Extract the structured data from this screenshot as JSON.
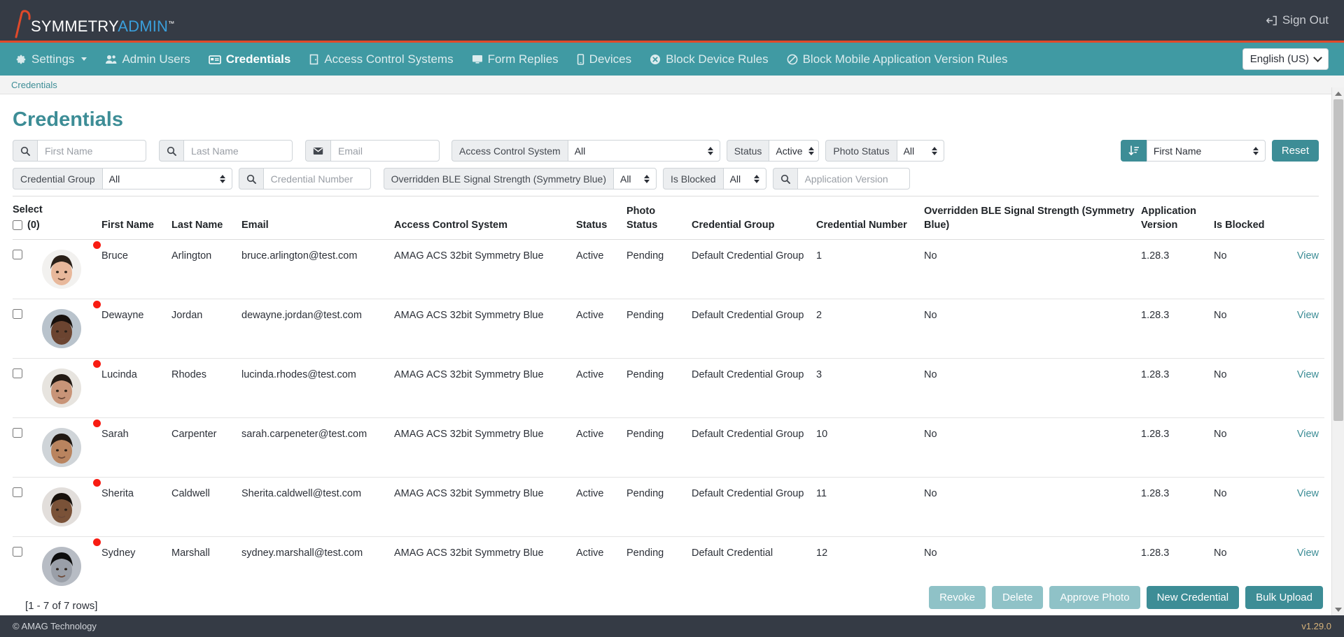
{
  "brand": {
    "name_primary": "SYMMETRY",
    "name_secondary": "ADMIN",
    "trademark": "™",
    "colors": {
      "navy": "#353b45",
      "teal": "#409aa3",
      "accent_red": "#e0492a",
      "link_teal": "#3d8d96",
      "logo_blue": "#3a9fdb"
    }
  },
  "topbar": {
    "sign_out_label": "Sign Out",
    "sign_out_icon": "sign-out-icon"
  },
  "nav": {
    "items": [
      {
        "label": "Settings",
        "icon": "gear-icon",
        "active": false,
        "has_caret": true
      },
      {
        "label": "Admin Users",
        "icon": "users-icon",
        "active": false,
        "has_caret": false
      },
      {
        "label": "Credentials",
        "icon": "card-icon",
        "active": true,
        "has_caret": false
      },
      {
        "label": "Access Control Systems",
        "icon": "door-icon",
        "active": false,
        "has_caret": false
      },
      {
        "label": "Form Replies",
        "icon": "monitor-icon",
        "active": false,
        "has_caret": false
      },
      {
        "label": "Devices",
        "icon": "mobile-icon",
        "active": false,
        "has_caret": false
      },
      {
        "label": "Block Device Rules",
        "icon": "circle-x-icon",
        "active": false,
        "has_caret": false
      },
      {
        "label": "Block Mobile Application Version Rules",
        "icon": "ban-icon",
        "active": false,
        "has_caret": false
      }
    ],
    "language": {
      "value": "English (US)",
      "icon": "chevron-down-icon"
    }
  },
  "breadcrumb": {
    "items": [
      "Credentials"
    ]
  },
  "page": {
    "title": "Credentials"
  },
  "filters": {
    "row1": [
      {
        "type": "search",
        "name": "first-name",
        "icon": "search-icon",
        "placeholder": "First Name",
        "value": ""
      },
      {
        "type": "search",
        "name": "last-name",
        "icon": "search-icon",
        "placeholder": "Last Name",
        "value": ""
      },
      {
        "type": "search",
        "name": "email",
        "icon": "envelope-icon",
        "placeholder": "Email",
        "value": ""
      },
      {
        "type": "select",
        "name": "access-control-system",
        "label": "Access Control System",
        "value": "All"
      },
      {
        "type": "select",
        "name": "status",
        "label": "Status",
        "value": "Active"
      },
      {
        "type": "select",
        "name": "photo-status",
        "label": "Photo Status",
        "value": "All"
      }
    ],
    "sort": {
      "label": "First Name",
      "icon": "sort-icon"
    },
    "reset_label": "Reset",
    "row2": [
      {
        "type": "select",
        "name": "credential-group",
        "label": "Credential Group",
        "value": "All"
      },
      {
        "type": "search",
        "name": "credential-number",
        "icon": "search-icon",
        "placeholder": "Credential Number",
        "value": ""
      },
      {
        "type": "select",
        "name": "overridden-ble-signal-strength",
        "label": "Overridden BLE Signal Strength (Symmetry Blue)",
        "value": "All"
      },
      {
        "type": "select",
        "name": "is-blocked",
        "label": "Is Blocked",
        "value": "All"
      },
      {
        "type": "search",
        "name": "application-version",
        "icon": "search-icon",
        "placeholder": "Application Version",
        "value": ""
      }
    ]
  },
  "table": {
    "select_header": "Select",
    "select_count": "(0)",
    "columns": [
      "First Name",
      "Last Name",
      "Email",
      "Access Control System",
      "Status",
      "Photo Status",
      "Credential Group",
      "Credential Number",
      "Overridden BLE Signal Strength (Symmetry Blue)",
      "Application Version",
      "Is Blocked"
    ],
    "view_label": "View",
    "rows": [
      {
        "first_name": "Bruce",
        "last_name": "Arlington",
        "email": "bruce.arlington@test.com",
        "acs": "AMAG ACS 32bit Symmetry Blue",
        "status": "Active",
        "photo_status": "Pending",
        "credential_group": "Default Credential Group",
        "credential_number": "1",
        "ble": "No",
        "app_version": "1.28.3",
        "is_blocked": "No",
        "avatar_skin": "#e8b89b",
        "avatar_hair": "#2b2119",
        "avatar_bg": "#f2f1ef"
      },
      {
        "first_name": "Dewayne",
        "last_name": "Jordan",
        "email": "dewayne.jordan@test.com",
        "acs": "AMAG ACS 32bit Symmetry Blue",
        "status": "Active",
        "photo_status": "Pending",
        "credential_group": "Default Credential Group",
        "credential_number": "2",
        "ble": "No",
        "app_version": "1.28.3",
        "is_blocked": "No",
        "avatar_skin": "#6b4430",
        "avatar_hair": "#17100c",
        "avatar_bg": "#b9c3cc"
      },
      {
        "first_name": "Lucinda",
        "last_name": "Rhodes",
        "email": "lucinda.rhodes@test.com",
        "acs": "AMAG ACS 32bit Symmetry Blue",
        "status": "Active",
        "photo_status": "Pending",
        "credential_group": "Default Credential Group",
        "credential_number": "3",
        "ble": "No",
        "app_version": "1.28.3",
        "is_blocked": "No",
        "avatar_skin": "#c89478",
        "avatar_hair": "#231a14",
        "avatar_bg": "#e7e4df"
      },
      {
        "first_name": "Sarah",
        "last_name": "Carpenter",
        "email": "sarah.carpeneter@test.com",
        "acs": "AMAG ACS 32bit Symmetry Blue",
        "status": "Active",
        "photo_status": "Pending",
        "credential_group": "Default Credential Group",
        "credential_number": "10",
        "ble": "No",
        "app_version": "1.28.3",
        "is_blocked": "No",
        "avatar_skin": "#b9845f",
        "avatar_hair": "#211913",
        "avatar_bg": "#cfd4d8"
      },
      {
        "first_name": "Sherita",
        "last_name": "Caldwell",
        "email": "Sherita.caldwell@test.com",
        "acs": "AMAG ACS 32bit Symmetry Blue",
        "status": "Active",
        "photo_status": "Pending",
        "credential_group": "Default Credential Group",
        "credential_number": "11",
        "ble": "No",
        "app_version": "1.28.3",
        "is_blocked": "No",
        "avatar_skin": "#7a5238",
        "avatar_hair": "#18110c",
        "avatar_bg": "#e2dedb"
      },
      {
        "first_name": "Sydney",
        "last_name": "Marshall",
        "email": "sydney.marshall@test.com",
        "acs": "AMAG ACS 32bit Symmetry Blue",
        "status": "Active",
        "photo_status": "Pending",
        "credential_group": "Default Credential",
        "credential_number": "12",
        "ble": "No",
        "app_version": "1.28.3",
        "is_blocked": "No",
        "avatar_skin": "#9a9fa8",
        "avatar_hair": "#0d0d0d",
        "avatar_bg": "#b7bcc4"
      }
    ],
    "rows_info": "[1 - 7 of 7 rows]"
  },
  "actions": [
    {
      "label": "Revoke",
      "name": "revoke-button",
      "style": "light"
    },
    {
      "label": "Delete",
      "name": "delete-button",
      "style": "light"
    },
    {
      "label": "Approve Photo",
      "name": "approve-photo-button",
      "style": "light"
    },
    {
      "label": "New Credential",
      "name": "new-credential-button",
      "style": "solid"
    },
    {
      "label": "Bulk Upload",
      "name": "bulk-upload-button",
      "style": "solid"
    }
  ],
  "footer": {
    "copyright": "© AMAG Technology",
    "version": "v1.29.0"
  }
}
